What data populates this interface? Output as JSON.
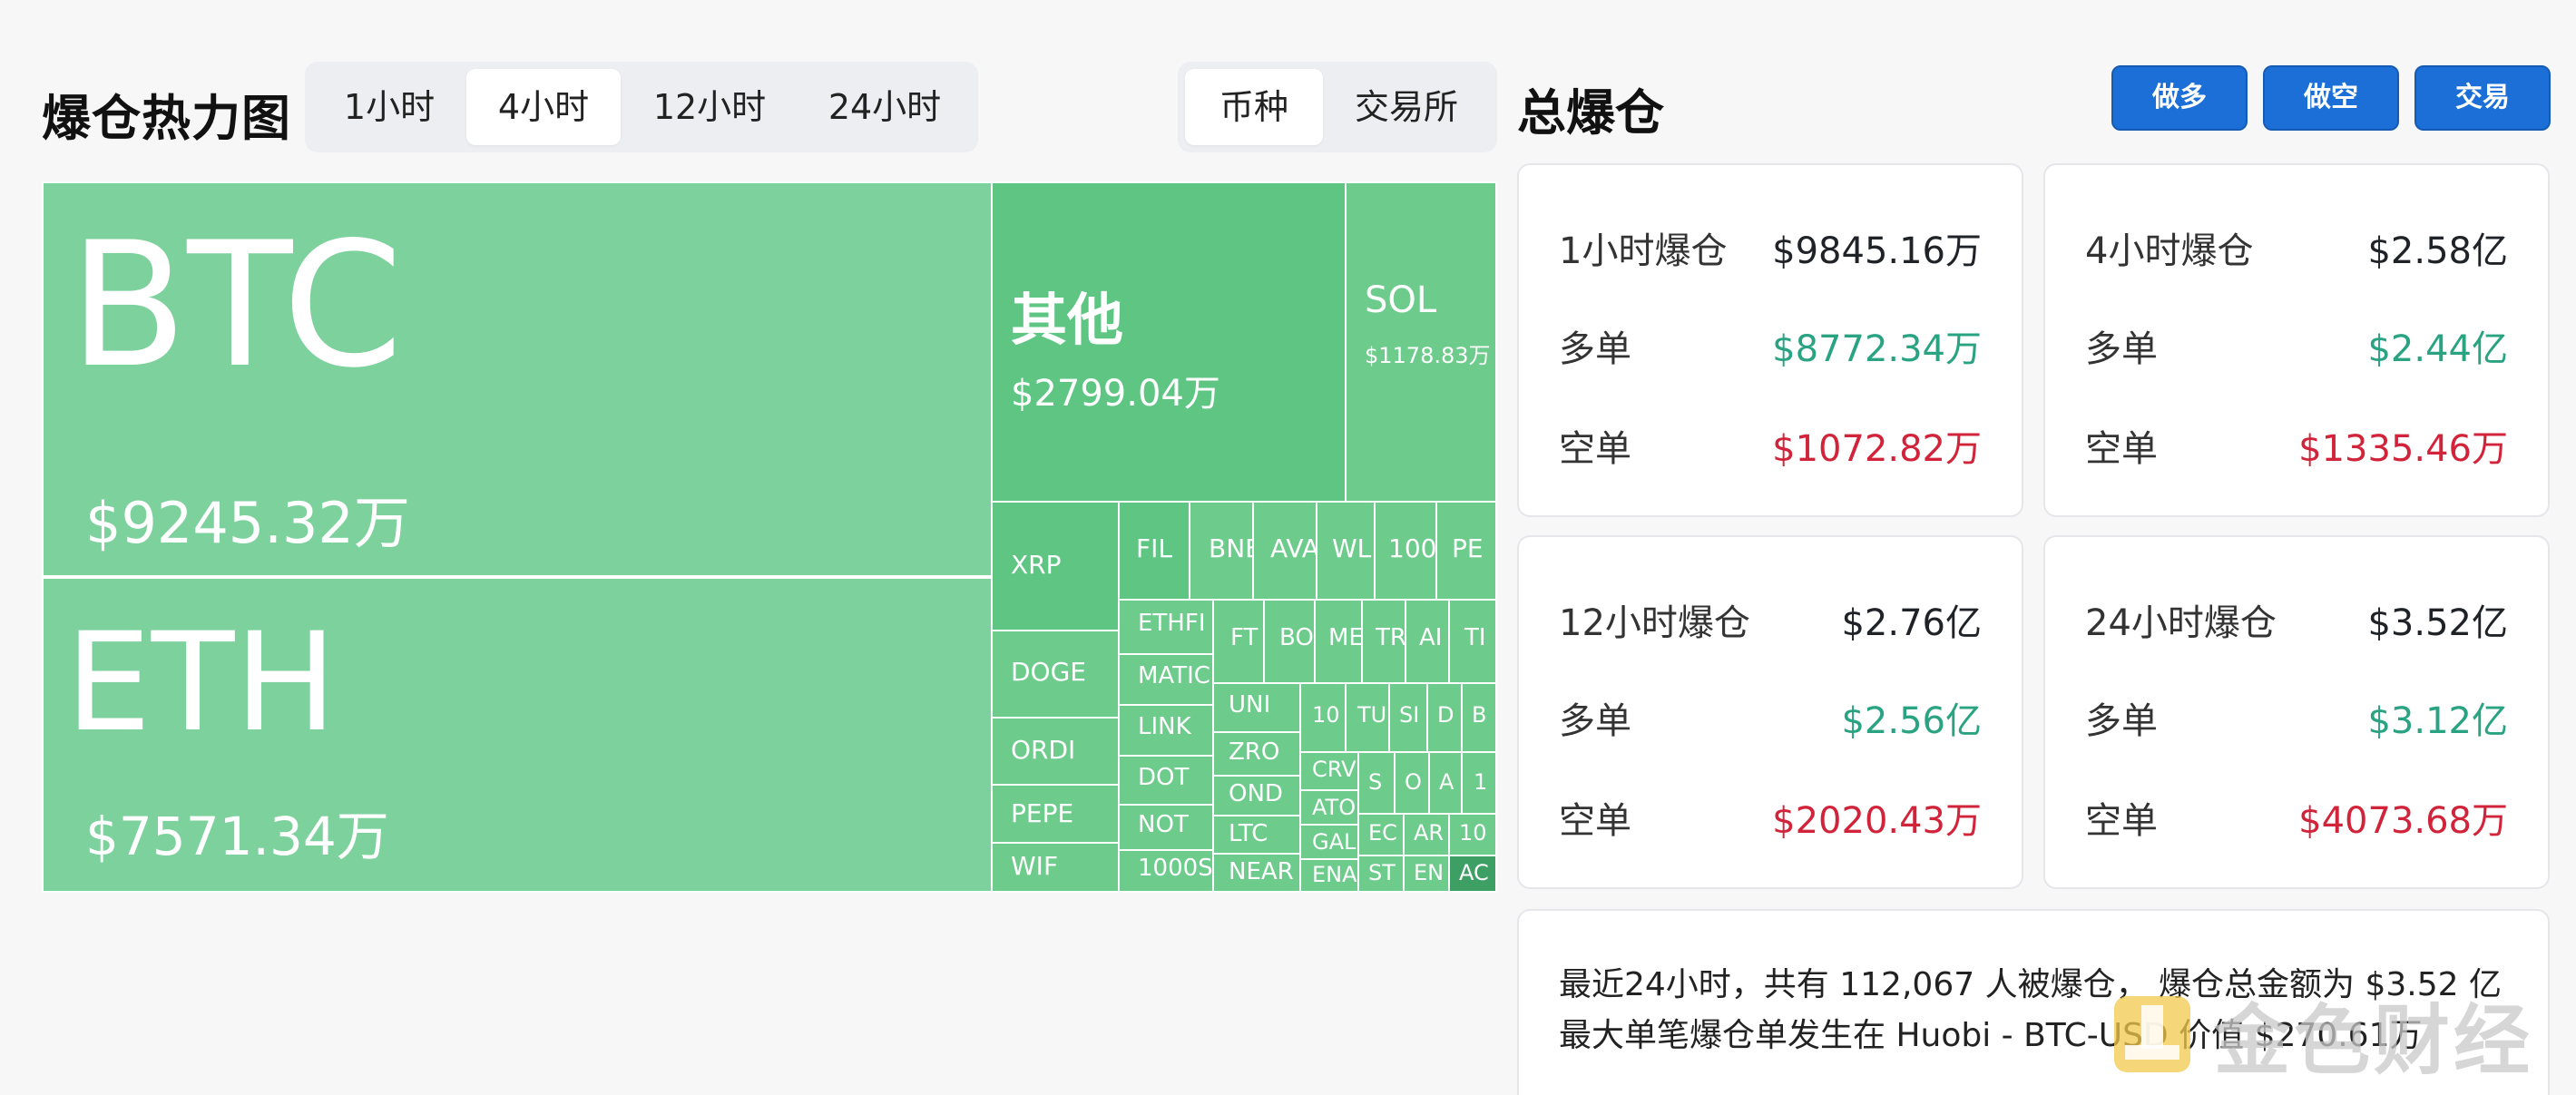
{
  "heatmap": {
    "title": "爆仓热力图",
    "time_tabs": [
      "1小时",
      "4小时",
      "12小时",
      "24小时"
    ],
    "active_time_tab": "4小时",
    "group_tabs": [
      "币种",
      "交易所"
    ],
    "active_group_tab": "币种",
    "tile_color": "#6dcb8b",
    "tiles": {
      "btc": {
        "symbol": "BTC",
        "value": "$9245.32万"
      },
      "eth": {
        "symbol": "ETH",
        "value": "$7571.34万"
      },
      "other": {
        "symbol": "其他",
        "value": "$2799.04万"
      },
      "sol": {
        "symbol": "SOL",
        "value": "$1178.83万"
      },
      "xrp": {
        "symbol": "XRP"
      },
      "doge": {
        "symbol": "DOGE"
      },
      "ordi": {
        "symbol": "ORDI"
      },
      "pepe": {
        "symbol": "PEPE"
      },
      "wif": {
        "symbol": "WIF"
      },
      "fil": {
        "symbol": "FIL"
      },
      "bnb": {
        "symbol": "BNB"
      },
      "avax": {
        "symbol": "AVA"
      },
      "wld": {
        "symbol": "WL"
      },
      "t100": {
        "symbol": "100"
      },
      "pe": {
        "symbol": "PE"
      },
      "ethfi": {
        "symbol": "ETHFI"
      },
      "matic": {
        "symbol": "MATIC"
      },
      "link": {
        "symbol": "LINK"
      },
      "dot": {
        "symbol": "DOT"
      },
      "not": {
        "symbol": "NOT"
      },
      "t1000s": {
        "symbol": "1000S"
      },
      "ft": {
        "symbol": "FT"
      },
      "bo": {
        "symbol": "BO"
      },
      "me": {
        "symbol": "ME"
      },
      "tr": {
        "symbol": "TR"
      },
      "ai": {
        "symbol": "AI"
      },
      "ti": {
        "symbol": "TI"
      },
      "uni": {
        "symbol": "UNI"
      },
      "zro": {
        "symbol": "ZRO"
      },
      "ondo": {
        "symbol": "OND"
      },
      "ltc": {
        "symbol": "LTC"
      },
      "near": {
        "symbol": "NEAR"
      },
      "t10": {
        "symbol": "10"
      },
      "tu": {
        "symbol": "TU"
      },
      "si": {
        "symbol": "SI"
      },
      "di": {
        "symbol": "D"
      },
      "bi": {
        "symbol": "B"
      },
      "crv": {
        "symbol": "CRV"
      },
      "atom": {
        "symbol": "ATO"
      },
      "gala": {
        "symbol": "GAL"
      },
      "ena": {
        "symbol": "ENA"
      },
      "s1": {
        "symbol": "S"
      },
      "o1": {
        "symbol": "O"
      },
      "a1": {
        "symbol": "A"
      },
      "n1": {
        "symbol": "1"
      },
      "ec": {
        "symbol": "EC"
      },
      "ar": {
        "symbol": "AR"
      },
      "t10b": {
        "symbol": "10"
      },
      "st": {
        "symbol": "ST"
      },
      "en": {
        "symbol": "EN"
      },
      "ac": {
        "symbol": "AC"
      }
    }
  },
  "total": {
    "title": "总爆仓",
    "buttons": {
      "long": "做多",
      "short": "做空",
      "trade": "交易"
    },
    "cards": [
      {
        "label": "1小时爆仓",
        "total": "$9845.16万",
        "long_label": "多单",
        "long": "$8772.34万",
        "short_label": "空单",
        "short": "$1072.82万"
      },
      {
        "label": "4小时爆仓",
        "total": "$2.58亿",
        "long_label": "多单",
        "long": "$2.44亿",
        "short_label": "空单",
        "short": "$1335.46万"
      },
      {
        "label": "12小时爆仓",
        "total": "$2.76亿",
        "long_label": "多单",
        "long": "$2.56亿",
        "short_label": "空单",
        "short": "$2020.43万"
      },
      {
        "label": "24小时爆仓",
        "total": "$3.52亿",
        "long_label": "多单",
        "long": "$3.12亿",
        "short_label": "空单",
        "short": "$4073.68万"
      }
    ],
    "summary_line1": "最近24小时，共有 112,067 人被爆仓， 爆仓总金额为 $3.52 亿",
    "summary_line2": "最大单笔爆仓单发生在 Huobi - BTC-USD 价值 $270.61万"
  },
  "watermark": "金色财经",
  "colors": {
    "accent": "#1b6fd6",
    "long": "#2aa382",
    "short": "#d1243a"
  }
}
